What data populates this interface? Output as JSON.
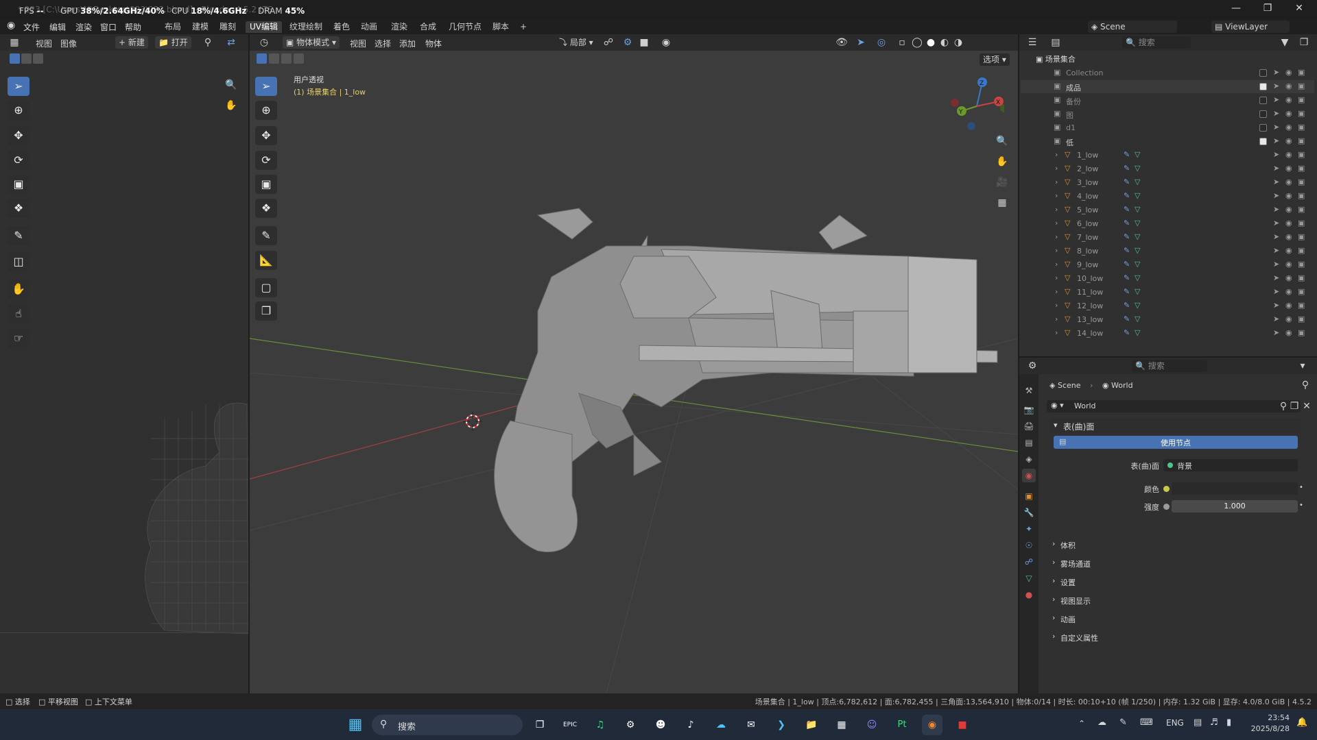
{
  "titlebar": {
    "title": "* 223 [C:\\Users\\M\\Desktop\\223\\223.blend] - Blender 4.5.2 LTS",
    "fps_label": "FPS",
    "fps_value": "--",
    "gpu_label": "GPU",
    "gpu_value": "38%/2.64GHz/40%",
    "cpu_label": "CPU",
    "cpu_value": "18%/4.6GHz",
    "dram_label": "DRAM",
    "dram_value": "45%"
  },
  "menu": {
    "items": [
      "文件",
      "编辑",
      "渲染",
      "窗口",
      "帮助"
    ]
  },
  "workspaces": {
    "tabs": [
      "布局",
      "建模",
      "雕刻",
      "UV编辑",
      "纹理绘制",
      "着色",
      "动画",
      "渲染",
      "合成",
      "几何节点",
      "脚本"
    ],
    "active": "UV编辑"
  },
  "scene_selector": {
    "label": "Scene"
  },
  "viewlayer_selector": {
    "label": "ViewLayer"
  },
  "uv_editor": {
    "view": "视图",
    "image": "图像",
    "new": "新建",
    "open": "打开"
  },
  "viewport": {
    "mode": "物体模式",
    "view": "视图",
    "select": "选择",
    "add": "添加",
    "object": "物体",
    "transform": "局部",
    "options": "选项",
    "overlay_title": "用户透视",
    "overlay_subtitle": "(1) 场景集合 | 1_low",
    "gizmo": {
      "x": "X",
      "y": "Y",
      "z": "Z"
    }
  },
  "outliner": {
    "search_placeholder": "搜索",
    "root": "场景集合",
    "rows": [
      {
        "name": "Collection",
        "checked": false,
        "dim": true
      },
      {
        "name": "成品",
        "checked": true,
        "dim": false
      },
      {
        "name": "备份",
        "checked": false,
        "dim": true
      },
      {
        "name": "图",
        "checked": false,
        "dim": true
      },
      {
        "name": "d1",
        "checked": false,
        "dim": true
      },
      {
        "name": "低",
        "checked": true,
        "dim": false
      }
    ],
    "objects": [
      "1_low",
      "2_low",
      "3_low",
      "4_low",
      "5_low",
      "6_low",
      "7_low",
      "8_low",
      "9_low",
      "10_low",
      "11_low",
      "12_low",
      "13_low",
      "14_low"
    ]
  },
  "properties": {
    "search_placeholder": "搜索",
    "breadcrumb_scene": "Scene",
    "breadcrumb_world": "World",
    "world_name": "World",
    "surface_section": "表(曲)面",
    "use_nodes": "使用节点",
    "surface_label": "表(曲)面",
    "surface_value": "背景",
    "color_label": "颜色",
    "strength_label": "强度",
    "strength_value": "1.000",
    "sections": [
      "体积",
      "雾场通道",
      "设置",
      "视图显示",
      "动画",
      "自定义属性"
    ]
  },
  "statusbar": {
    "select": "选择",
    "pan": "平移视图",
    "context": "上下文菜单",
    "stats": "场景集合 | 1_low | 顶点:6,782,612 | 面:6,782,455 | 三角面:13,564,910 | 物体:0/14 | 时长: 00:10+10 (帧 1/250) | 内存: 1.32 GiB | 显存: 4.0/8.0 GiB | 4.5.2"
  },
  "taskbar": {
    "search": "搜索",
    "lang": "ENG",
    "time": "23:54",
    "date": "2025/8/28"
  },
  "colors": {
    "accent": "#4772b3",
    "bg": "#303030",
    "header": "#2b2b2b",
    "taskbar": "#202a38"
  }
}
